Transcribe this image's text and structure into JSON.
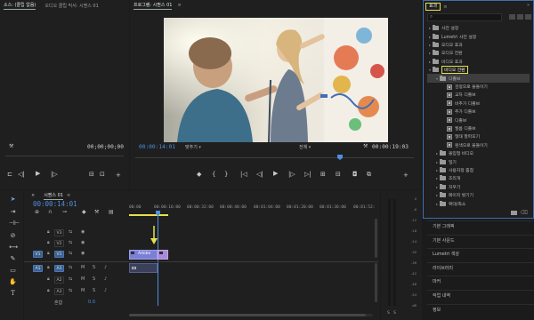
{
  "source_panel": {
    "tabs": [
      "소스: (클립 없음)",
      "오디오 클립 믹서: 시퀀스 01"
    ],
    "timecode_left": "",
    "timecode_right": "00;00;00;00"
  },
  "program_panel": {
    "tab": "프로그램: 시퀀스 01",
    "timecode_left": "00:00:14:01",
    "fit_label": "맞추기",
    "quality_label": "전체",
    "timecode_right": "00:00:19:03"
  },
  "timeline": {
    "tab": "시퀀스 01",
    "timecode": "00:00:14:01",
    "ruler_labels": [
      "00:00",
      "00:00:16:00",
      "00:00:32:00",
      "00:00:48:00",
      "00:01:04:00",
      "00:01:20:00",
      "00:01:36:00",
      "00:01:52:"
    ],
    "video_tracks": [
      "V3",
      "V2",
      "V1"
    ],
    "audio_tracks": [
      "A1",
      "A2",
      "A3"
    ],
    "master_label": "혼합",
    "master_value": "0.0",
    "clip_label": "Adobe",
    "track_letters": {
      "mute": "M",
      "solo": "S"
    }
  },
  "meter": {
    "ticks": [
      "0",
      "-6",
      "-12",
      "-18",
      "-24",
      "-30",
      "-36",
      "-42",
      "-48",
      "-54",
      "dB"
    ],
    "footer": [
      "S",
      "S"
    ]
  },
  "effects": {
    "tab": "효과",
    "search_placeholder": "",
    "items": [
      {
        "label": "사전 설정",
        "type": "folder",
        "indent": 0
      },
      {
        "label": "Lumetri 사전 설정",
        "type": "folder",
        "indent": 0
      },
      {
        "label": "오디오 효과",
        "type": "folder",
        "indent": 0
      },
      {
        "label": "오디오 전환",
        "type": "folder",
        "indent": 0
      },
      {
        "label": "비디오 효과",
        "type": "folder",
        "indent": 0
      },
      {
        "label": "비디오 전환",
        "type": "folder",
        "indent": 0,
        "open": true,
        "highlight": true
      },
      {
        "label": "디졸브",
        "type": "folder",
        "indent": 1,
        "open": true,
        "selected": true
      },
      {
        "label": "검정으로 물들이기",
        "type": "fx",
        "indent": 2
      },
      {
        "label": "교차 디졸브",
        "type": "fx",
        "indent": 2
      },
      {
        "label": "비추가 디졸브",
        "type": "fx",
        "indent": 2
      },
      {
        "label": "추가 디졸브",
        "type": "fx",
        "indent": 2
      },
      {
        "label": "디졸브",
        "type": "fx",
        "indent": 2
      },
      {
        "label": "필름 디졸브",
        "type": "fx",
        "indent": 2
      },
      {
        "label": "형태 할파포기",
        "type": "fx",
        "indent": 2
      },
      {
        "label": "흰색으로 물들이기",
        "type": "fx",
        "indent": 2
      },
      {
        "label": "몰입형 비디오",
        "type": "folder",
        "indent": 1
      },
      {
        "label": "밀기",
        "type": "folder",
        "indent": 1
      },
      {
        "label": "사용자정 줌점",
        "type": "folder",
        "indent": 1
      },
      {
        "label": "조리개",
        "type": "folder",
        "indent": 1
      },
      {
        "label": "지우기",
        "type": "folder",
        "indent": 1
      },
      {
        "label": "페이지 벗기기",
        "type": "folder",
        "indent": 1
      },
      {
        "label": "확대/축소",
        "type": "folder",
        "indent": 1
      }
    ]
  },
  "side_panels": [
    "기본 그래픽",
    "기본 사운드",
    "Lumetri 색상",
    "라이브러리",
    "마커",
    "작업 내역",
    "정보"
  ],
  "colors": {
    "accent_blue": "#4d8fe0",
    "highlight_yellow": "#e6e04a",
    "clip_video": "#7b7fd6",
    "clip_audio": "#3a3f5c",
    "playhead": "#4d8fe0"
  }
}
